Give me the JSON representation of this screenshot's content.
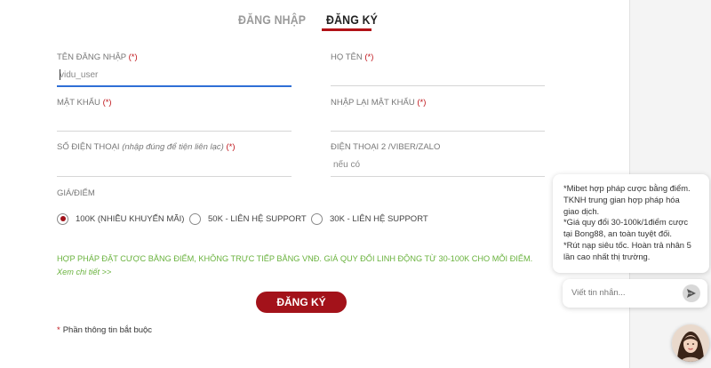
{
  "tabs": {
    "login": "ĐĂNG NHẬP",
    "register": "ĐĂNG KÝ"
  },
  "form": {
    "username": {
      "label": "TÊN ĐĂNG NHẬP",
      "required": "(*)",
      "placeholder": "vidu_user"
    },
    "fullname": {
      "label": "HỌ TÊN",
      "required": "(*)",
      "placeholder": ""
    },
    "password": {
      "label": "MẬT KHẨU",
      "required": "(*)",
      "placeholder": ""
    },
    "password_confirm": {
      "label": "NHẬP LẠI MẬT KHẨU",
      "required": "(*)",
      "placeholder": ""
    },
    "phone": {
      "label": "SỐ ĐIỆN THOẠI",
      "hint": "(nhập đúng để tiện liên lạc)",
      "required": "(*)",
      "placeholder": ""
    },
    "phone2": {
      "label": "ĐIỆN THOẠI 2 /VIBER/ZALO",
      "placeholder": "nếu có"
    }
  },
  "price": {
    "label": "GIÁ/ĐIỂM",
    "options": [
      {
        "label": "100K (NHIỀU KHUYẾN MÃI)",
        "checked": true
      },
      {
        "label": "50K - LIÊN HỆ SUPPORT",
        "checked": false
      },
      {
        "label": "30K - LIÊN HỆ SUPPORT",
        "checked": false
      }
    ]
  },
  "notice": {
    "text": "HỢP PHÁP ĐẶT CƯỢC BẰNG ĐIỂM, KHÔNG TRỰC TIẾP BẰNG VNĐ. GIÁ QUY ĐỔI LINH ĐỘNG TỪ 30-100K CHO MỖI ĐIỂM.",
    "link": "Xem chi tiết >>"
  },
  "submit_label": "ĐĂNG KÝ",
  "required_note": {
    "mark": "*",
    "text": "Phần thông tin bắt buộc"
  },
  "chat": {
    "lines": [
      "*Mibet hợp pháp cược bằng điểm.",
      "TKNH trung gian hợp pháp hóa",
      "giao dịch.",
      "*Giá quy đổi 30-100k/1điểm cược",
      "tại Bong88, an toàn tuyệt đối.",
      "*Rút nạp siêu tốc. Hoàn trả nhân 5",
      "lần cao nhất thị trường."
    ],
    "input_placeholder": "Viết tin nhắn...",
    "send_icon": "send-icon",
    "avatar_icon": "support-avatar"
  },
  "colors": {
    "brand_red": "#a3121a",
    "required_red": "#c0171d",
    "notice_green": "#69b23d",
    "focus_blue": "#2f6fd6"
  }
}
